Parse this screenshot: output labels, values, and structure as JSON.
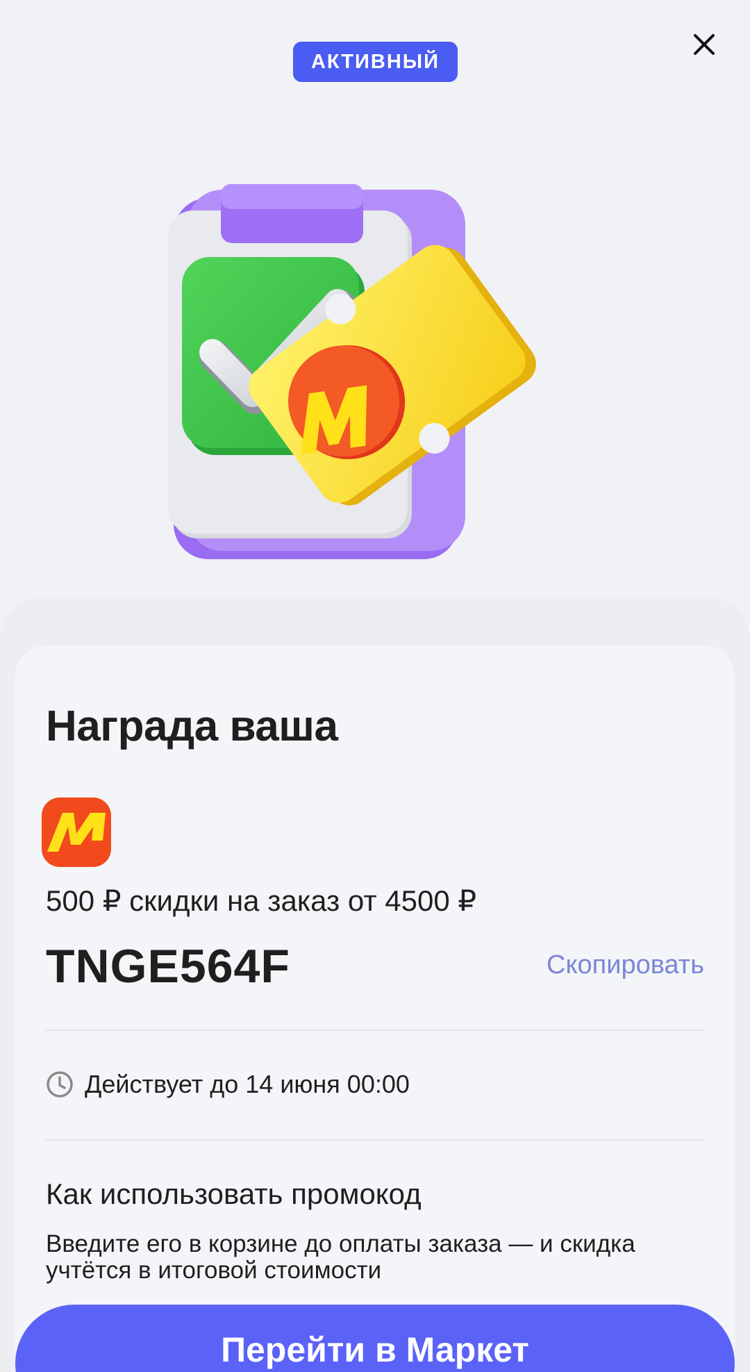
{
  "status_badge": "АКТИВНЫЙ",
  "close_icon": "close-icon",
  "reward": {
    "title": "Награда ваша",
    "brand_logo": "yandex-market-logo",
    "offer": "500 ₽ скидки на заказ от 4500 ₽",
    "promo_code": "TNGE564F",
    "copy_label": "Скопировать",
    "valid_until": "Действует до 14 июня 00:00",
    "howto_title": "Как использовать промокод",
    "howto_text": "Введите его в корзине до оплаты заказа — и скидка учтётся в итоговой стоимости"
  },
  "cta_label": "Перейти в Маркет",
  "colors": {
    "accent": "#5b62f8",
    "badge": "#4a5cf2",
    "link": "#7a86d8",
    "brand_red": "#f04a1d",
    "brand_yellow": "#ffe11a"
  }
}
